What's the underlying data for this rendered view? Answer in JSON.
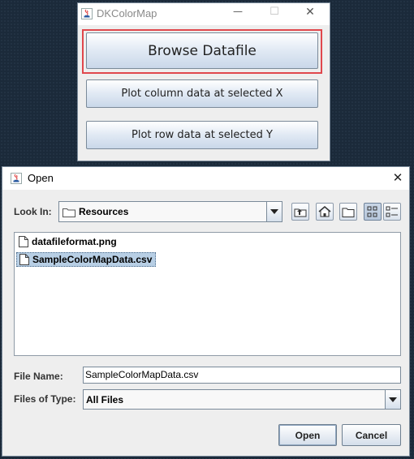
{
  "main_window": {
    "title": "DKColorMap",
    "controls": {
      "minimize": "—",
      "maximize": "☐",
      "close": "✕"
    },
    "buttons": {
      "browse": "Browse Datafile",
      "plot_column": "Plot column data at selected X",
      "plot_row": "Plot row data at selected Y"
    },
    "highlight_color": "#e0474c"
  },
  "open_dialog": {
    "title": "Open",
    "close": "✕",
    "look_in_label": "Look In:",
    "look_in_value": "Resources",
    "toolbar_icons": [
      "up-one-level-icon",
      "home-icon",
      "new-folder-icon",
      "list-view-icon",
      "details-view-icon"
    ],
    "files": [
      {
        "name": "datafileformat.png",
        "selected": false
      },
      {
        "name": "SampleColorMapData.csv",
        "selected": true
      }
    ],
    "file_name_label": "File Name:",
    "file_name_value": "SampleColorMapData.csv",
    "files_of_type_label": "Files of Type:",
    "files_of_type_value": "All Files",
    "open_button": "Open",
    "cancel_button": "Cancel",
    "selection_color": "#b8cfe5"
  }
}
